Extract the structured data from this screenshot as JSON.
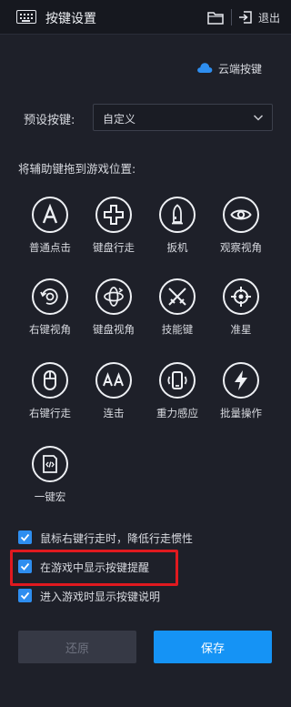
{
  "header": {
    "title": "按键设置",
    "exit_label": "退出",
    "icons": [
      "keyboard-icon",
      "folder-icon",
      "exit-icon"
    ]
  },
  "cloud": {
    "label": "云端按键",
    "icon": "cloud-icon",
    "accent": "#2e8ef0"
  },
  "preset": {
    "label": "预设按键:",
    "value": "自定义"
  },
  "drag_hint": "将辅助键拖到游戏位置:",
  "tools": [
    {
      "label": "普通点击",
      "icon": "letter-a-icon"
    },
    {
      "label": "键盘行走",
      "icon": "dpad-icon"
    },
    {
      "label": "扳机",
      "icon": "bullet-icon"
    },
    {
      "label": "观察视角",
      "icon": "eye-icon"
    },
    {
      "label": "右键视角",
      "icon": "rotate-view-icon"
    },
    {
      "label": "键盘视角",
      "icon": "orbit-view-icon"
    },
    {
      "label": "技能键",
      "icon": "crossed-swords-icon"
    },
    {
      "label": "准星",
      "icon": "crosshair-icon"
    },
    {
      "label": "右键行走",
      "icon": "mouse-icon"
    },
    {
      "label": "连击",
      "icon": "double-a-icon"
    },
    {
      "label": "重力感应",
      "icon": "phone-shake-icon"
    },
    {
      "label": "批量操作",
      "icon": "lightning-icon"
    },
    {
      "label": "一键宏",
      "icon": "macro-script-icon"
    }
  ],
  "options": [
    {
      "label": "鼠标右键行走时，降低行走惯性",
      "checked": true
    },
    {
      "label": "在游戏中显示按键提醒",
      "checked": true
    },
    {
      "label": "进入游戏时显示按键说明",
      "checked": true
    }
  ],
  "buttons": {
    "reset": "还原",
    "save": "保存"
  },
  "colors": {
    "background": "#1e2029",
    "primary": "#1593f5",
    "highlight": "#e0191f"
  }
}
